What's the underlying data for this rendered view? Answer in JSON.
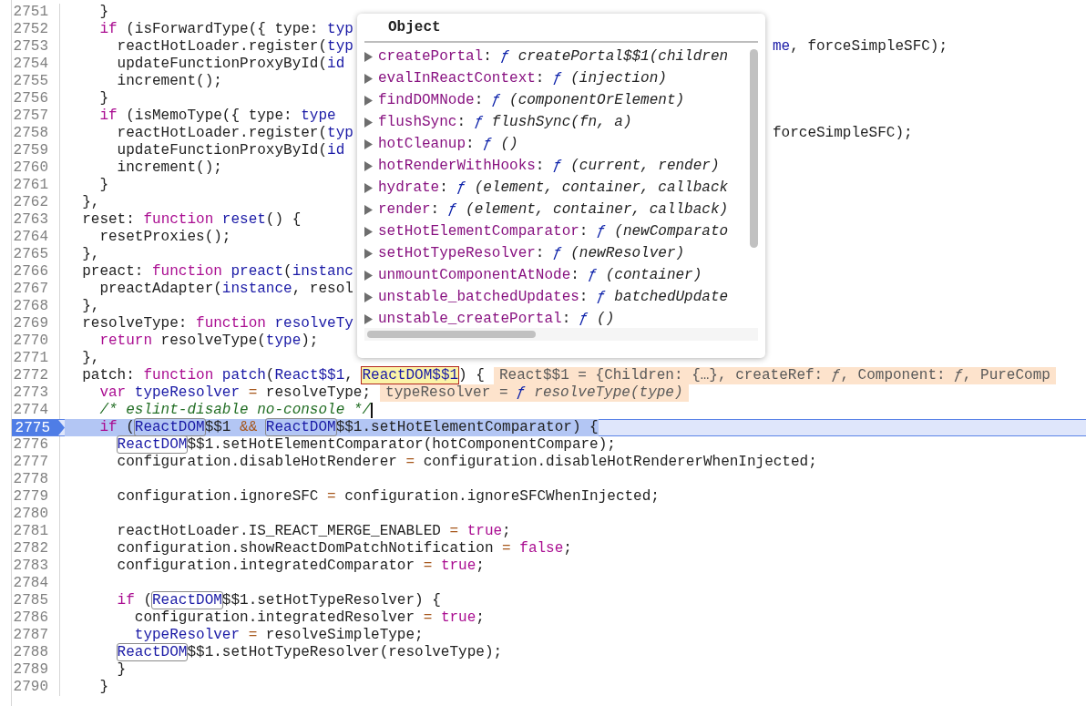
{
  "editor": {
    "lines": [
      {
        "number": "2751",
        "current": false,
        "caret": false,
        "tokens": [
          {
            "kind": "plain",
            "text": "    }"
          }
        ]
      },
      {
        "number": "2752",
        "current": false,
        "caret": false,
        "tokens": [
          {
            "kind": "keyword",
            "text": "    if"
          },
          {
            "kind": "plain",
            "text": " (isForwardType({ type: "
          },
          {
            "kind": "name",
            "text": "typ"
          }
        ]
      },
      {
        "number": "2753",
        "current": false,
        "caret": false,
        "tokens": [
          {
            "kind": "plain",
            "text": "      reactHotLoader.register("
          },
          {
            "kind": "name",
            "text": "typ"
          }
        ],
        "right_tokens": [
          {
            "kind": "name",
            "text": "me"
          },
          {
            "kind": "plain",
            "text": ", forceSimpleSFC);"
          }
        ]
      },
      {
        "number": "2754",
        "current": false,
        "caret": false,
        "tokens": [
          {
            "kind": "plain",
            "text": "      updateFunctionProxyById("
          },
          {
            "kind": "name",
            "text": "id"
          }
        ]
      },
      {
        "number": "2755",
        "current": false,
        "caret": false,
        "tokens": [
          {
            "kind": "plain",
            "text": "      increment();"
          }
        ]
      },
      {
        "number": "2756",
        "current": false,
        "caret": false,
        "tokens": [
          {
            "kind": "plain",
            "text": "    }"
          }
        ]
      },
      {
        "number": "2757",
        "current": false,
        "caret": false,
        "tokens": [
          {
            "kind": "keyword",
            "text": "    if"
          },
          {
            "kind": "plain",
            "text": " (isMemoType({ type: "
          },
          {
            "kind": "name",
            "text": "type"
          }
        ]
      },
      {
        "number": "2758",
        "current": false,
        "caret": false,
        "tokens": [
          {
            "kind": "plain",
            "text": "      reactHotLoader.register("
          },
          {
            "kind": "name",
            "text": "typ"
          }
        ],
        "right_tokens": [
          {
            "kind": "plain",
            "text": "forceSimpleSFC);"
          }
        ]
      },
      {
        "number": "2759",
        "current": false,
        "caret": false,
        "tokens": [
          {
            "kind": "plain",
            "text": "      updateFunctionProxyById("
          },
          {
            "kind": "name",
            "text": "id"
          }
        ]
      },
      {
        "number": "2760",
        "current": false,
        "caret": false,
        "tokens": [
          {
            "kind": "plain",
            "text": "      increment();"
          }
        ]
      },
      {
        "number": "2761",
        "current": false,
        "caret": false,
        "tokens": [
          {
            "kind": "plain",
            "text": "    }"
          }
        ]
      },
      {
        "number": "2762",
        "current": false,
        "caret": false,
        "tokens": [
          {
            "kind": "plain",
            "text": "  },"
          }
        ]
      },
      {
        "number": "2763",
        "current": false,
        "caret": false,
        "tokens": [
          {
            "kind": "plain",
            "text": "  reset: "
          },
          {
            "kind": "keyword",
            "text": "function "
          },
          {
            "kind": "name",
            "text": "reset"
          },
          {
            "kind": "plain",
            "text": "() {"
          }
        ]
      },
      {
        "number": "2764",
        "current": false,
        "caret": false,
        "tokens": [
          {
            "kind": "plain",
            "text": "    resetProxies();"
          }
        ]
      },
      {
        "number": "2765",
        "current": false,
        "caret": false,
        "tokens": [
          {
            "kind": "plain",
            "text": "  },"
          }
        ]
      },
      {
        "number": "2766",
        "current": false,
        "caret": false,
        "tokens": [
          {
            "kind": "plain",
            "text": "  preact: "
          },
          {
            "kind": "keyword",
            "text": "function "
          },
          {
            "kind": "name",
            "text": "preact"
          },
          {
            "kind": "plain",
            "text": "("
          },
          {
            "kind": "name",
            "text": "instanc"
          }
        ]
      },
      {
        "number": "2767",
        "current": false,
        "caret": false,
        "tokens": [
          {
            "kind": "plain",
            "text": "    preactAdapter("
          },
          {
            "kind": "name",
            "text": "instance"
          },
          {
            "kind": "plain",
            "text": ", resol"
          }
        ]
      },
      {
        "number": "2768",
        "current": false,
        "caret": false,
        "tokens": [
          {
            "kind": "plain",
            "text": "  },"
          }
        ]
      },
      {
        "number": "2769",
        "current": false,
        "caret": false,
        "tokens": [
          {
            "kind": "plain",
            "text": "  resolveType: "
          },
          {
            "kind": "keyword",
            "text": "function "
          },
          {
            "kind": "name",
            "text": "resolveTy"
          }
        ]
      },
      {
        "number": "2770",
        "current": false,
        "caret": false,
        "tokens": [
          {
            "kind": "keyword",
            "text": "    return"
          },
          {
            "kind": "plain",
            "text": " resolveType("
          },
          {
            "kind": "name",
            "text": "type"
          },
          {
            "kind": "plain",
            "text": ");"
          }
        ]
      },
      {
        "number": "2771",
        "current": false,
        "caret": false,
        "tokens": [
          {
            "kind": "plain",
            "text": "  },"
          }
        ]
      },
      {
        "number": "2772",
        "current": false,
        "caret": false,
        "tokens": [
          {
            "kind": "plain",
            "text": "  patch: "
          },
          {
            "kind": "keyword",
            "text": "function "
          },
          {
            "kind": "name",
            "text": "patch"
          },
          {
            "kind": "plain",
            "text": "("
          },
          {
            "kind": "name",
            "text": "React$$1"
          },
          {
            "kind": "plain",
            "text": ", "
          },
          {
            "kind": "hovered",
            "text": "ReactDOM$$1"
          },
          {
            "kind": "plain",
            "text": ") {"
          }
        ],
        "inline_values": [
          {
            "kind": "value",
            "text": "React$$1 = {Children: {…}, createRef: "
          },
          {
            "kind": "value-italic",
            "text": "ƒ"
          },
          {
            "kind": "value",
            "text": ", Component: "
          },
          {
            "kind": "value-italic",
            "text": "ƒ"
          },
          {
            "kind": "value",
            "text": ", PureComp"
          }
        ]
      },
      {
        "number": "2773",
        "current": false,
        "caret": false,
        "tokens": [
          {
            "kind": "keyword",
            "text": "    var "
          },
          {
            "kind": "name",
            "text": "typeResolver"
          },
          {
            "kind": "op",
            "text": " = "
          },
          {
            "kind": "plain",
            "text": "resolveType;"
          }
        ],
        "inline_values": [
          {
            "kind": "value",
            "text": "typeResolver = "
          },
          {
            "kind": "value-fn",
            "text": "ƒ"
          },
          {
            "kind": "value-italic",
            "text": " resolveType(type)"
          }
        ]
      },
      {
        "number": "2774",
        "current": false,
        "caret": true,
        "tokens": [
          {
            "kind": "comment",
            "text": "    /* eslint-disable no-console */"
          }
        ]
      },
      {
        "number": "2775",
        "current": true,
        "caret": false,
        "tokens": [
          {
            "kind": "keyword",
            "text": "    if"
          },
          {
            "kind": "plain",
            "text": " ("
          },
          {
            "kind": "boxed",
            "text": "ReactDOM"
          },
          {
            "kind": "plain",
            "text": "$$1 "
          },
          {
            "kind": "op",
            "text": "&& "
          },
          {
            "kind": "boxed",
            "text": "ReactDOM"
          },
          {
            "kind": "plain",
            "text": "$$1.setHotElementComparator) {"
          }
        ]
      },
      {
        "number": "2776",
        "current": false,
        "caret": false,
        "tokens": [
          {
            "kind": "boxed",
            "text": "ReactDOM",
            "indented": true
          },
          {
            "kind": "plain",
            "text": "$$1.setHotElementComparator(hotComponentCompare);"
          }
        ]
      },
      {
        "number": "2777",
        "current": false,
        "caret": false,
        "tokens": [
          {
            "kind": "plain",
            "text": "      configuration.disableHotRenderer "
          },
          {
            "kind": "op",
            "text": "= "
          },
          {
            "kind": "plain",
            "text": "configuration.disableHotRendererWhenInjected;"
          }
        ]
      },
      {
        "number": "2778",
        "current": false,
        "caret": false
      },
      {
        "number": "2779",
        "current": false,
        "caret": false,
        "tokens": [
          {
            "kind": "plain",
            "text": "      configuration.ignoreSFC "
          },
          {
            "kind": "op",
            "text": "= "
          },
          {
            "kind": "plain",
            "text": "configuration.ignoreSFCWhenInjected;"
          }
        ]
      },
      {
        "number": "2780",
        "current": false,
        "caret": false
      },
      {
        "number": "2781",
        "current": false,
        "caret": false,
        "tokens": [
          {
            "kind": "plain",
            "text": "      reactHotLoader.IS_REACT_MERGE_ENABLED "
          },
          {
            "kind": "op",
            "text": "= "
          },
          {
            "kind": "keyword",
            "text": "true"
          },
          {
            "kind": "plain",
            "text": ";"
          }
        ]
      },
      {
        "number": "2782",
        "current": false,
        "caret": false,
        "tokens": [
          {
            "kind": "plain",
            "text": "      configuration.showReactDomPatchNotification "
          },
          {
            "kind": "op",
            "text": "= "
          },
          {
            "kind": "keyword",
            "text": "false"
          },
          {
            "kind": "plain",
            "text": ";"
          }
        ]
      },
      {
        "number": "2783",
        "current": false,
        "caret": false,
        "tokens": [
          {
            "kind": "plain",
            "text": "      configuration.integratedComparator "
          },
          {
            "kind": "op",
            "text": "= "
          },
          {
            "kind": "keyword",
            "text": "true"
          },
          {
            "kind": "plain",
            "text": ";"
          }
        ]
      },
      {
        "number": "2784",
        "current": false,
        "caret": false
      },
      {
        "number": "2785",
        "current": false,
        "caret": false,
        "tokens": [
          {
            "kind": "keyword",
            "text": "      if"
          },
          {
            "kind": "plain",
            "text": " ("
          },
          {
            "kind": "boxed",
            "text": "ReactDOM"
          },
          {
            "kind": "plain",
            "text": "$$1.setHotTypeResolver) {"
          }
        ]
      },
      {
        "number": "2786",
        "current": false,
        "caret": false,
        "tokens": [
          {
            "kind": "plain",
            "text": "        configuration.integratedResolver "
          },
          {
            "kind": "op",
            "text": "= "
          },
          {
            "kind": "keyword",
            "text": "true"
          },
          {
            "kind": "plain",
            "text": ";"
          }
        ]
      },
      {
        "number": "2787",
        "current": false,
        "caret": false,
        "tokens": [
          {
            "kind": "name",
            "text": "        typeResolver"
          },
          {
            "kind": "op",
            "text": " = "
          },
          {
            "kind": "plain",
            "text": "resolveSimpleType;"
          }
        ]
      },
      {
        "number": "2788",
        "current": false,
        "caret": false,
        "tokens": [
          {
            "kind": "boxed",
            "text": "ReactDOM",
            "indented": true
          },
          {
            "kind": "plain",
            "text": "$$1.setHotTypeResolver(resolveType);"
          }
        ]
      },
      {
        "number": "2789",
        "current": false,
        "caret": false,
        "tokens": [
          {
            "kind": "plain",
            "text": "      }"
          }
        ]
      },
      {
        "number": "2790",
        "current": false,
        "caret": false,
        "tokens": [
          {
            "kind": "plain",
            "text": "    }"
          }
        ]
      }
    ]
  },
  "popover": {
    "title": "Object",
    "properties": [
      {
        "name": "createPortal",
        "separator": ":",
        "mark": "ƒ",
        "signature": "createPortal$$1(children"
      },
      {
        "name": "evalInReactContext",
        "separator": ":",
        "mark": "ƒ",
        "signature": "(injection)"
      },
      {
        "name": "findDOMNode",
        "separator": ":",
        "mark": "ƒ",
        "signature": "(componentOrElement)"
      },
      {
        "name": "flushSync",
        "separator": ":",
        "mark": "ƒ",
        "signature": "flushSync(fn, a)"
      },
      {
        "name": "hotCleanup",
        "separator": ":",
        "mark": "ƒ",
        "signature": "()"
      },
      {
        "name": "hotRenderWithHooks",
        "separator": ":",
        "mark": "ƒ",
        "signature": "(current, render)"
      },
      {
        "name": "hydrate",
        "separator": ":",
        "mark": "ƒ",
        "signature": "(element, container, callback"
      },
      {
        "name": "render",
        "separator": ":",
        "mark": "ƒ",
        "signature": "(element, container, callback)"
      },
      {
        "name": "setHotElementComparator",
        "separator": ":",
        "mark": "ƒ",
        "signature": "(newComparato"
      },
      {
        "name": "setHotTypeResolver",
        "separator": ":",
        "mark": "ƒ",
        "signature": "(newResolver)"
      },
      {
        "name": "unmountComponentAtNode",
        "separator": ":",
        "mark": "ƒ",
        "signature": "(container)"
      },
      {
        "name": "unstable_batchedUpdates",
        "separator": ":",
        "mark": "ƒ",
        "signature": "batchedUpdate"
      },
      {
        "name": "unstable_createPortal",
        "separator": ":",
        "mark": "ƒ",
        "signature": "()"
      }
    ]
  }
}
